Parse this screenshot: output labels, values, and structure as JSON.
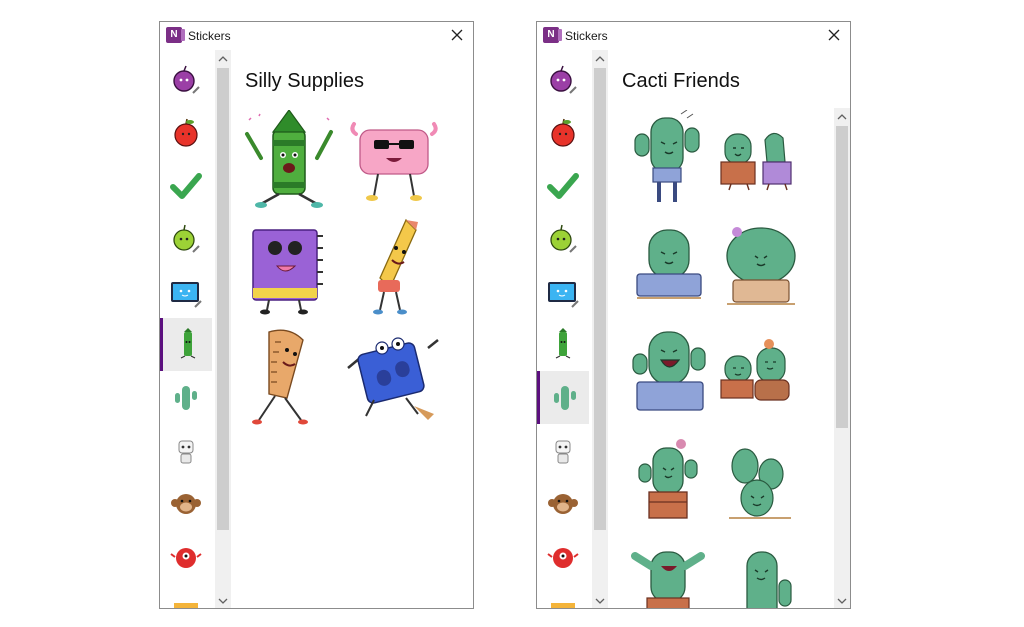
{
  "left_panel": {
    "window_title": "Stickers",
    "app_icon_letter": "N",
    "heading": "Silly Supplies",
    "stickers": [
      {
        "icon": "crayon-sticker-icon"
      },
      {
        "icon": "eraser-sticker-icon"
      },
      {
        "icon": "notebook-sticker-icon"
      },
      {
        "icon": "pencil-sticker-icon"
      },
      {
        "icon": "ruler-sticker-icon"
      },
      {
        "icon": "sharpener-sticker-icon"
      }
    ]
  },
  "right_panel": {
    "window_title": "Stickers",
    "app_icon_letter": "N",
    "heading": "Cacti Friends",
    "stickers": [
      {
        "icon": "tall-cactus-sticker-icon"
      },
      {
        "icon": "cactus-pair-sticker-icon"
      },
      {
        "icon": "cactus-blue-pot-sticker-icon"
      },
      {
        "icon": "round-cactus-sticker-icon"
      },
      {
        "icon": "laughing-cactus-sticker-icon"
      },
      {
        "icon": "cactus-trio-sticker-icon"
      },
      {
        "icon": "flower-cactus-sticker-icon"
      },
      {
        "icon": "prickly-pear-sticker-icon"
      },
      {
        "icon": "dancing-cactus-sticker-icon"
      },
      {
        "icon": "tall-cactus-2-sticker-icon"
      }
    ]
  },
  "categories": [
    {
      "icon": "purple-fruit-sticker-icon"
    },
    {
      "icon": "apple-sticker-icon"
    },
    {
      "icon": "checkmark-sticker-icon"
    },
    {
      "icon": "green-apple-sticker-icon"
    },
    {
      "icon": "tablet-sticker-icon"
    },
    {
      "icon": "crayon-category-icon"
    },
    {
      "icon": "cactus-category-icon"
    },
    {
      "icon": "robot-category-icon"
    },
    {
      "icon": "monkey-category-icon"
    },
    {
      "icon": "red-monster-category-icon"
    },
    {
      "icon": "pizza-category-icon"
    }
  ],
  "colors": {
    "selected_accent": "#5b0f7e",
    "app_icon": "#7b2f86",
    "cactus_green": "#5fb08a",
    "scrollbar_track": "#f0f0f0",
    "scrollbar_thumb": "#cdcdcd"
  }
}
